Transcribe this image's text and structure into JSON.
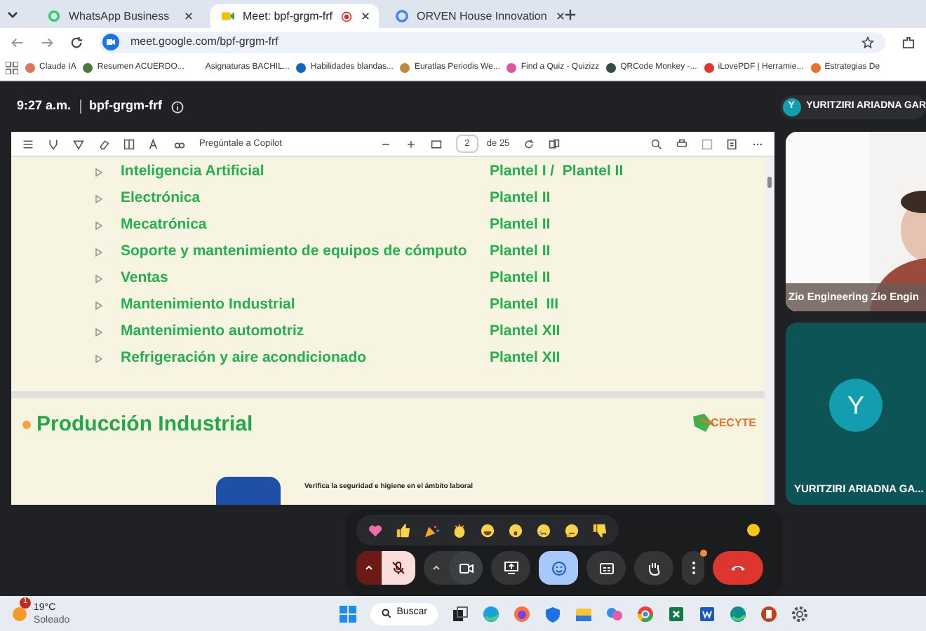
{
  "browser": {
    "tabs": [
      {
        "title": "WhatsApp Business",
        "kind": "whatsapp",
        "selected": false
      },
      {
        "title": "Meet: bpf-grgm-frf",
        "kind": "meet",
        "selected": true
      },
      {
        "title": "ORVEN House Innovation",
        "kind": "google",
        "selected": false
      }
    ],
    "url": "meet.google.com/bpf-grgm-frf",
    "bookmarks": [
      {
        "title": "Claude IA",
        "color": "#d97757"
      },
      {
        "title": "Resumen ACUERDO...",
        "color": "#4a7a3a"
      },
      {
        "title": "Asignaturas BACHIL..."
      },
      {
        "title": "Habilidades blandas...",
        "color": "#0a66c2"
      },
      {
        "title": "Euratlas Periodis We...",
        "color": "#c08a3a"
      },
      {
        "title": "Find a Quiz - Quizizz",
        "color": "#e0569a"
      },
      {
        "title": "QRCode Monkey -...",
        "color": "#2f4f3f"
      },
      {
        "title": "iLovePDF | Herramie...",
        "color": "#e5322d"
      },
      {
        "title": "Estrategias De",
        "color": "#e8702a"
      }
    ]
  },
  "meeting": {
    "time": "9:27 a.m.",
    "code": "bpf-grgm-frf",
    "presenter_initial": "Y",
    "presenter": "YURITZIRI ARIADNA GAR"
  },
  "pdf_toolbar": {
    "assistant": "Pregúntale a Copilot",
    "page": "2",
    "total": "de 25"
  },
  "slide": {
    "rows": [
      {
        "career": "Inteligencia Artificial",
        "campus": "Plantel I /  Plantel II"
      },
      {
        "career": "Electrónica",
        "campus": "Plantel II"
      },
      {
        "career": "Mecatrónica",
        "campus": "Plantel II"
      },
      {
        "career": "Soporte y mantenimiento de equipos de cómputo",
        "campus": "Plantel II"
      },
      {
        "career": "Ventas",
        "campus": "Plantel II"
      },
      {
        "career": "Mantenimiento Industrial",
        "campus": "Plantel  III"
      },
      {
        "career": "Mantenimiento automotriz",
        "campus": "Plantel XII"
      },
      {
        "career": "Refrigeración y aire acondicionado",
        "campus": "Plantel XII"
      }
    ],
    "section_title": "Producción Industrial",
    "logo": "CECYTE",
    "subtitle": "Verifica la seguridad e higiene en el ámbito laboral"
  },
  "tiles": [
    {
      "kind": "video",
      "name": "Zio Engineering Zio Engin"
    },
    {
      "kind": "avatar",
      "initial": "Y",
      "name": "YURITZIRI ARIADNA GA..."
    }
  ],
  "reactions": [
    {
      "kind": "heart"
    },
    {
      "kind": "thumbs-up"
    },
    {
      "kind": "party"
    },
    {
      "kind": "clap"
    },
    {
      "kind": "laugh"
    },
    {
      "kind": "wow"
    },
    {
      "kind": "sad"
    },
    {
      "kind": "think"
    },
    {
      "kind": "thumbs-down"
    }
  ],
  "controls": {
    "mic_muted": true,
    "reactions_open": true,
    "more_notification": true
  },
  "taskbar": {
    "temperature": "19°C",
    "weather": "Soleado",
    "weather_badge": "1",
    "search": "Buscar"
  }
}
